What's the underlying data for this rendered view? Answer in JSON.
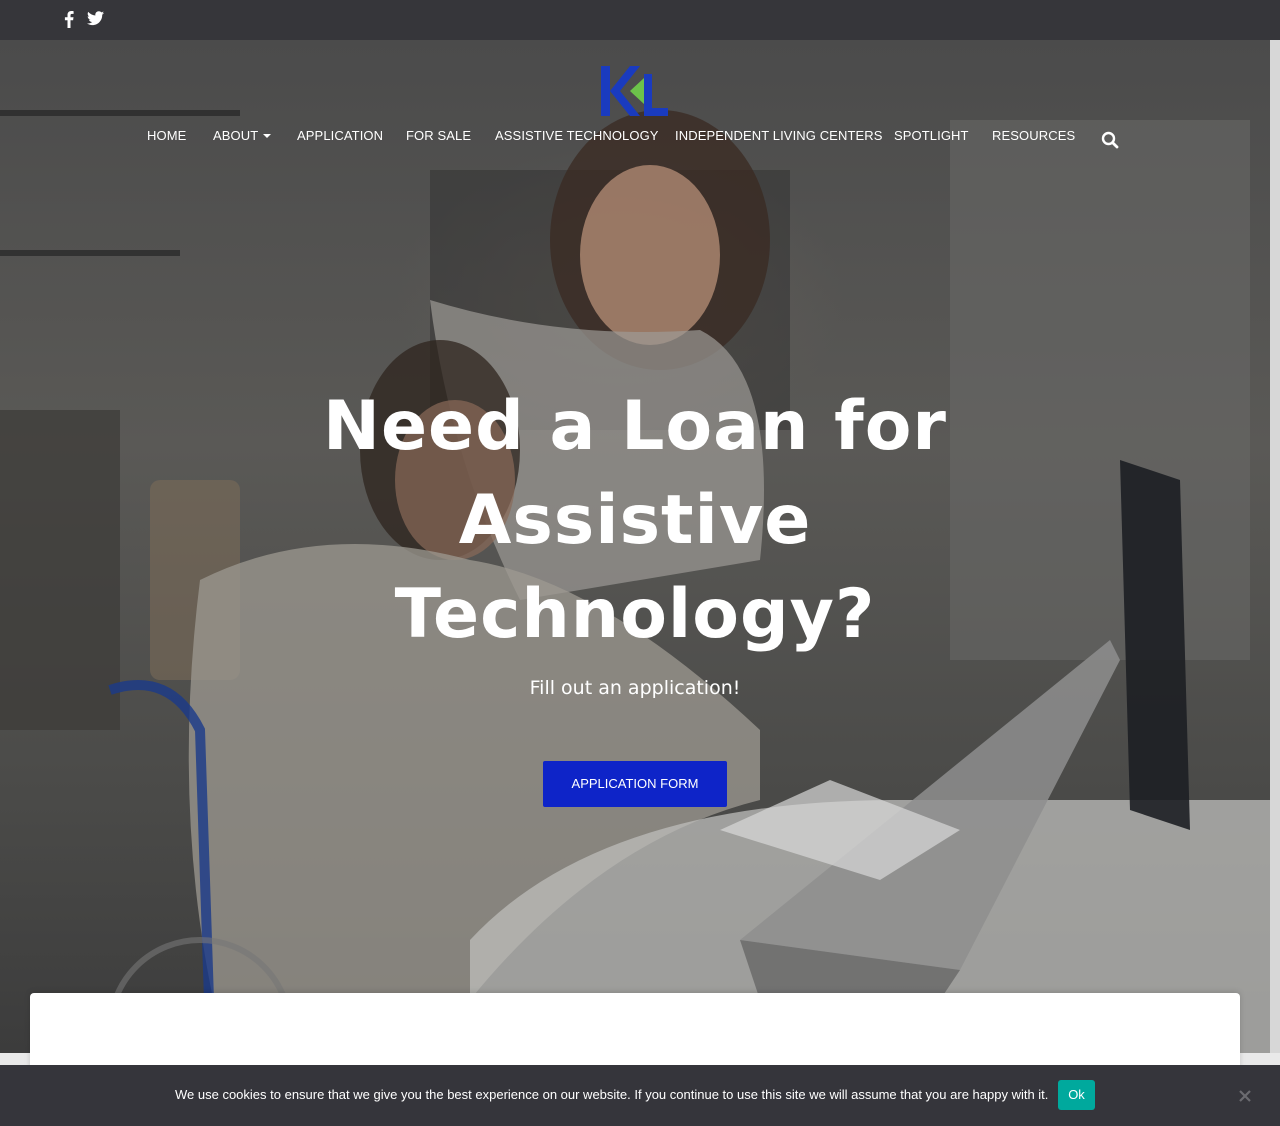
{
  "social": {
    "facebook_icon": "facebook-icon",
    "twitter_icon": "twitter-icon"
  },
  "logo": {
    "text": "KL",
    "colors": {
      "k": "#1a3bbf",
      "l": "#1a3bbf",
      "arrow": "#6cc24a"
    }
  },
  "nav": {
    "items": [
      {
        "label": "HOME"
      },
      {
        "label": "ABOUT",
        "has_dropdown": true
      },
      {
        "label": "APPLICATION"
      },
      {
        "label": "FOR SALE"
      },
      {
        "label": "ASSISTIVE TECHNOLOGY"
      },
      {
        "label": "INDEPENDENT LIVING CENTERS"
      },
      {
        "label": "SPOTLIGHT"
      },
      {
        "label": "RESOURCES"
      }
    ],
    "search_icon": "search-icon"
  },
  "hero": {
    "title_line1": "Need a Loan for",
    "title_line2": "Assistive",
    "title_line3": "Technology?",
    "subtitle": "Fill out an application!",
    "cta_label": "APPLICATION FORM",
    "cta_color": "#0e24c8"
  },
  "cookie": {
    "text": "We use cookies to ensure that we give you the best experience on our website. If you continue to use this site we will assume that you are happy with it.",
    "ok_label": "Ok",
    "ok_color": "#00a99d",
    "close_icon": "close-icon"
  }
}
